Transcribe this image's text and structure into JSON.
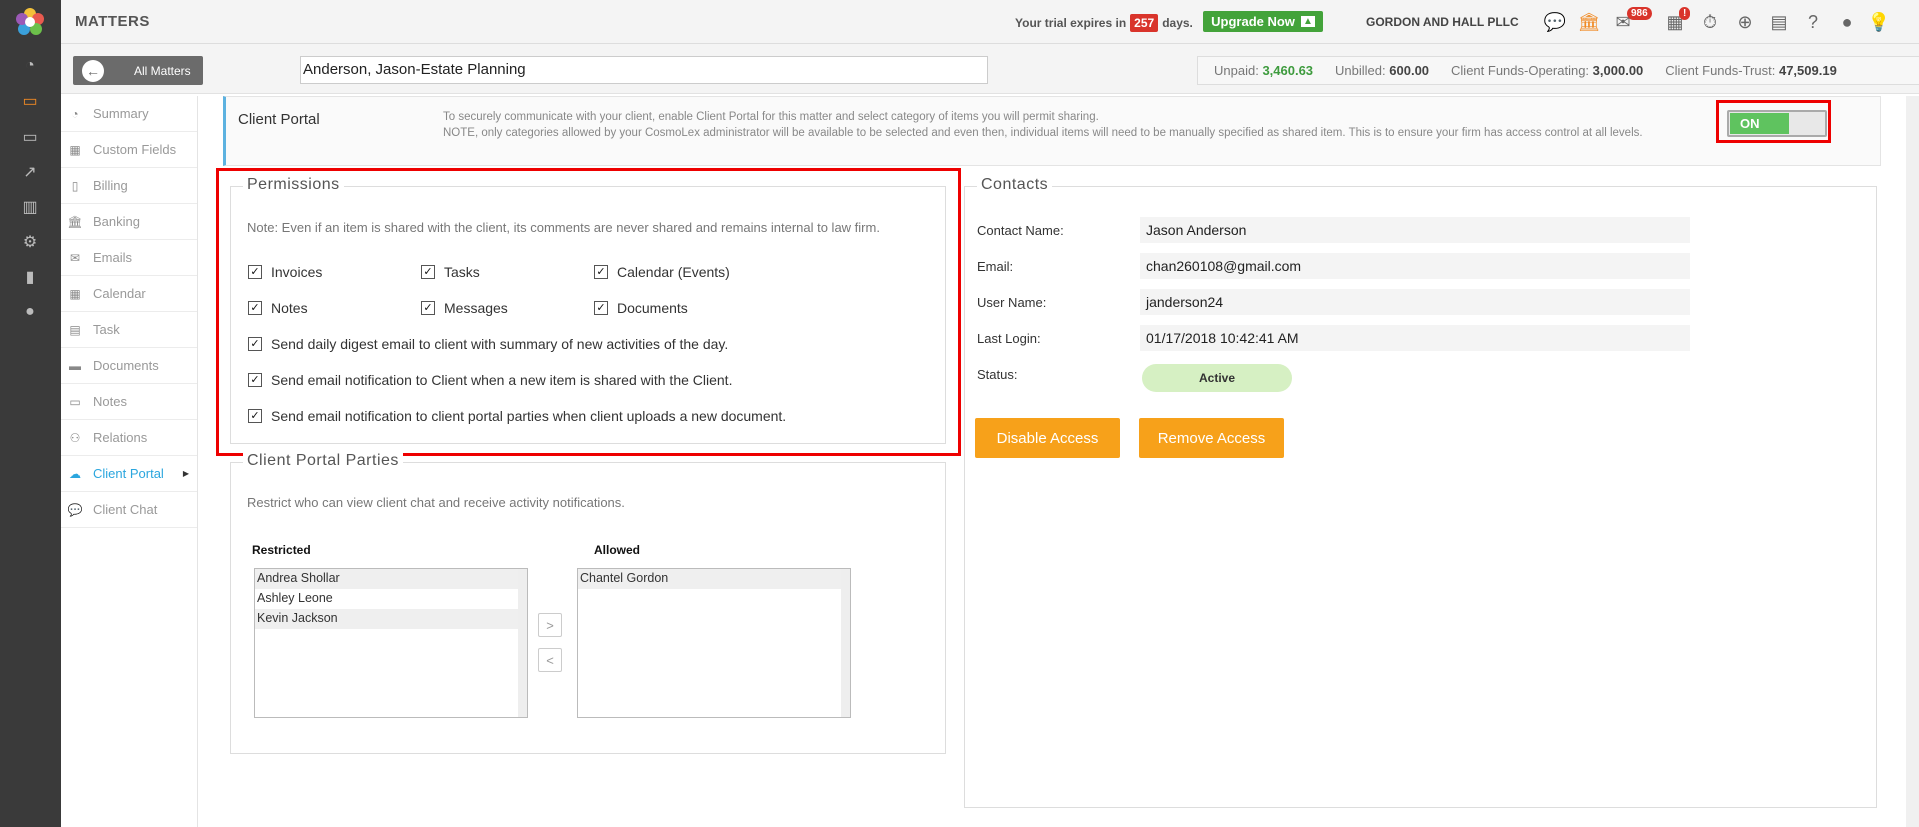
{
  "topbar": {
    "brand": "MATTERS",
    "trial_prefix": "Your trial expires in",
    "trial_days": "257",
    "trial_suffix": "days.",
    "upgrade_label": "Upgrade Now",
    "firm_name": "GORDON AND HALL PLLC",
    "mail_badge": "986",
    "calendar_badge": "!"
  },
  "subbar": {
    "all_matters_label": "All Matters",
    "matter_name": "Anderson, Jason-Estate Planning",
    "unpaid_label": "Unpaid:",
    "unpaid_value": "3,460.63",
    "unbilled_label": "Unbilled:",
    "unbilled_value": "600.00",
    "operating_label": "Client Funds-Operating:",
    "operating_value": "3,000.00",
    "trust_label": "Client Funds-Trust:",
    "trust_value": "47,509.19"
  },
  "sidenav": [
    {
      "label": "Summary",
      "icon": "gauge-icon"
    },
    {
      "label": "Custom Fields",
      "icon": "grid-icon"
    },
    {
      "label": "Billing",
      "icon": "file-icon"
    },
    {
      "label": "Banking",
      "icon": "bank-icon"
    },
    {
      "label": "Emails",
      "icon": "envelope-icon"
    },
    {
      "label": "Calendar",
      "icon": "calendar-icon"
    },
    {
      "label": "Task",
      "icon": "task-icon"
    },
    {
      "label": "Documents",
      "icon": "folder-icon"
    },
    {
      "label": "Notes",
      "icon": "note-icon"
    },
    {
      "label": "Relations",
      "icon": "relations-icon"
    },
    {
      "label": "Client Portal",
      "icon": "cloud-users-icon"
    },
    {
      "label": "Client Chat",
      "icon": "chat-icon"
    }
  ],
  "portal": {
    "title": "Client Portal",
    "desc_line1": "To securely communicate with your client, enable Client Portal for this matter and select category of items you will permit sharing.",
    "desc_line2": "NOTE, only categories allowed by your CosmoLex administrator will be available to be selected and even then, individual items will need to be manually specified as shared item. This is to ensure your firm has access control at all levels.",
    "toggle_label": "ON"
  },
  "permissions": {
    "legend": "Permissions",
    "note": "Note: Even if an item is shared with the client, its comments are never shared and remains internal to law firm.",
    "items": [
      "Invoices",
      "Tasks",
      "Calendar (Events)",
      "Notes",
      "Messages",
      "Documents"
    ],
    "opt1": "Send daily digest email to client with summary of new activities of the day.",
    "opt2": "Send email notification to Client when a new item is shared with the Client.",
    "opt3": "Send email notification to client portal parties when client uploads a new document.",
    "check_mark": "✓"
  },
  "parties": {
    "legend": "Client Portal Parties",
    "note": "Restrict who can view client chat and receive activity notifications.",
    "restricted_label": "Restricted",
    "allowed_label": "Allowed",
    "restricted": [
      "Andrea Shollar",
      "Ashley Leone",
      "Kevin Jackson"
    ],
    "allowed": [
      "Chantel Gordon"
    ],
    "move_right": ">",
    "move_left": "<"
  },
  "contacts": {
    "legend": "Contacts",
    "name_label": "Contact Name:",
    "name_value": "Jason Anderson",
    "email_label": "Email:",
    "email_value": "chan260108@gmail.com",
    "user_label": "User Name:",
    "user_value": "janderson24",
    "login_label": "Last Login:",
    "login_value": "01/17/2018 10:42:41 AM",
    "status_label": "Status:",
    "status_value": "Active",
    "disable_label": "Disable Access",
    "remove_label": "Remove Access"
  }
}
